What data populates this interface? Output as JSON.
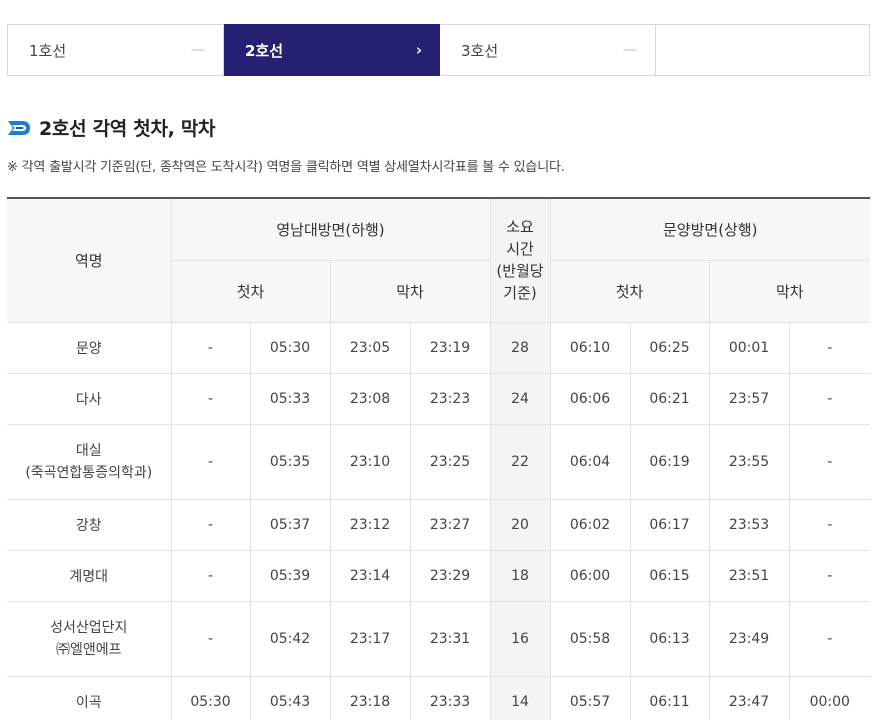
{
  "tabs": [
    {
      "label": "1호선",
      "icon": "minus-icon",
      "symbol": "—",
      "active": false
    },
    {
      "label": "2호선",
      "icon": "chevron-right-icon",
      "symbol": "›",
      "active": true
    },
    {
      "label": "3호선",
      "icon": "minus-icon",
      "symbol": "—",
      "active": false
    },
    {
      "label": "",
      "icon": "",
      "symbol": "",
      "active": false
    }
  ],
  "title": "2호선 각역 첫차, 막차",
  "notice": "※ 각역 출발시각 기준임(단, 종착역은 도착시각) 역명을 클릭하면 역별 상세열차시각표를 볼 수 있습니다.",
  "colors": {
    "active_tab": "#262073",
    "title_icon": "#1a7fd1"
  },
  "table": {
    "header": {
      "station": "역명",
      "dir_down": "영남대방면(하행)",
      "duration_lines": [
        "소요",
        "시간",
        "(반월당",
        "기준)"
      ],
      "dir_up": "문양방면(상행)",
      "first": "첫차",
      "last": "막차"
    },
    "rows": [
      {
        "station": [
          "문양"
        ],
        "cells": [
          "-",
          "05:30",
          "23:05",
          "23:19",
          "28",
          "06:10",
          "06:25",
          "00:01",
          "-"
        ]
      },
      {
        "station": [
          "다사"
        ],
        "cells": [
          "-",
          "05:33",
          "23:08",
          "23:23",
          "24",
          "06:06",
          "06:21",
          "23:57",
          "-"
        ]
      },
      {
        "station": [
          "대실",
          "(죽곡연합통증의학과)"
        ],
        "cells": [
          "-",
          "05:35",
          "23:10",
          "23:25",
          "22",
          "06:04",
          "06:19",
          "23:55",
          "-"
        ]
      },
      {
        "station": [
          "강창"
        ],
        "cells": [
          "-",
          "05:37",
          "23:12",
          "23:27",
          "20",
          "06:02",
          "06:17",
          "23:53",
          "-"
        ]
      },
      {
        "station": [
          "계명대"
        ],
        "cells": [
          "-",
          "05:39",
          "23:14",
          "23:29",
          "18",
          "06:00",
          "06:15",
          "23:51",
          "-"
        ]
      },
      {
        "station": [
          "성서산업단지",
          "㈜엘앤에프"
        ],
        "cells": [
          "-",
          "05:42",
          "23:17",
          "23:31",
          "16",
          "05:58",
          "06:13",
          "23:49",
          "-"
        ]
      },
      {
        "station": [
          "이곡"
        ],
        "cells": [
          "05:30",
          "05:43",
          "23:18",
          "23:33",
          "14",
          "05:57",
          "06:11",
          "23:47",
          "00:00"
        ]
      }
    ]
  }
}
